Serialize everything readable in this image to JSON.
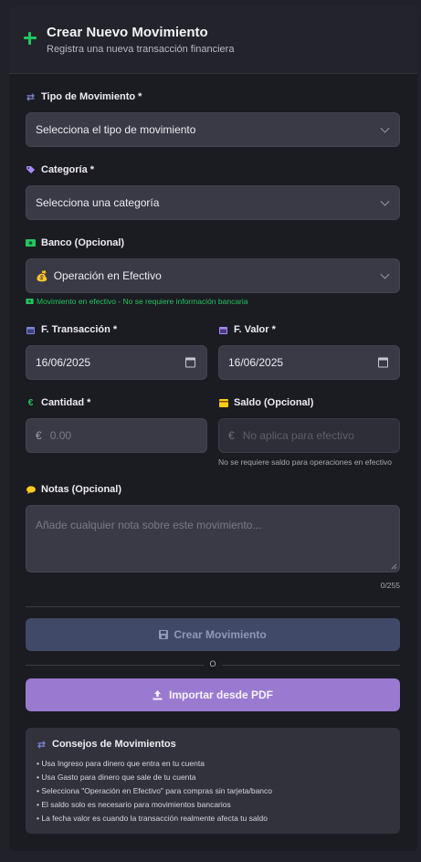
{
  "header": {
    "title": "Crear Nuevo Movimiento",
    "subtitle": "Registra una nueva transacción financiera"
  },
  "fields": {
    "tipo": {
      "label": "Tipo de Movimiento *",
      "value": "Selecciona el tipo de movimiento",
      "icon": "swap-arrows-icon"
    },
    "categoria": {
      "label": "Categoría *",
      "value": "Selecciona una categoría",
      "icon": "tag-icon"
    },
    "banco": {
      "label": "Banco (Opcional)",
      "value": "Operación en Efectivo",
      "value_icon": "💰",
      "hint": "Movimiento en efectivo - No se requiere información bancaria",
      "icon": "cash-icon"
    },
    "f_transaccion": {
      "label": "F. Transacción *",
      "value": "16/06/2025",
      "icon": "calendar-icon"
    },
    "f_valor": {
      "label": "F. Valor *",
      "value": "16/06/2025",
      "icon": "calendar-icon"
    },
    "cantidad": {
      "label": "Cantidad *",
      "prefix": "€",
      "placeholder": "0.00",
      "icon": "euro-icon"
    },
    "saldo": {
      "label": "Saldo (Opcional)",
      "prefix": "€",
      "placeholder": "No aplica para efectivo",
      "hint": "No se requiere saldo para operaciones en efectivo",
      "icon": "wallet-icon"
    },
    "notas": {
      "label": "Notas (Opcional)",
      "placeholder": "Añade cualquier nota sobre este movimiento...",
      "counter": "0/255",
      "icon": "speech-bubble-icon"
    }
  },
  "actions": {
    "create_label": "Crear Movimiento",
    "separator": "O",
    "import_label": "Importar desde PDF"
  },
  "tips": {
    "title": "Consejos de Movimientos",
    "items": [
      "• Usa Ingreso para dinero que entra en tu cuenta",
      "• Usa Gasto para dinero que sale de tu cuenta",
      "• Selecciona \"Operación en Efectivo\" para compras sin tarjeta/banco",
      "• El saldo solo es necesario para movimientos bancarios",
      "• La fecha valor es cuando la transacción realmente afecta tu saldo"
    ]
  },
  "colors": {
    "accent_green": "#22c55e",
    "create_button_bg": "#404a68",
    "import_button_bg": "#9a7ad0"
  }
}
